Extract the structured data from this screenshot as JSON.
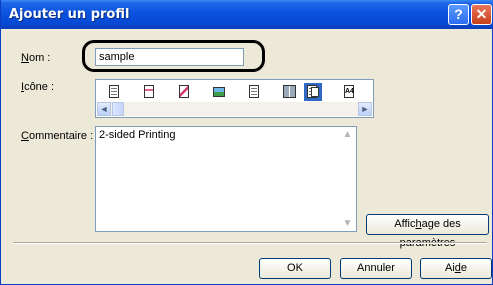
{
  "window": {
    "title": "Ajouter un profil"
  },
  "titlebar": {
    "help_glyph": "?",
    "close_glyph": "✕"
  },
  "name": {
    "label_first": "N",
    "label_rest": "om :",
    "value": "sample"
  },
  "icon_picker": {
    "label_first": "I",
    "label_rest": "cône :",
    "items": [
      "doc-icon",
      "color-doc-icon",
      "poster-icon",
      "photo-icon",
      "booklet-icon",
      "twoup-icon",
      "duplex-icon",
      "a4-icon"
    ],
    "a4_text": "A4",
    "selected_index": 6,
    "scroll_left": "◄",
    "scroll_right": "►"
  },
  "comment": {
    "label_first": "C",
    "label_rest": "ommentaire :",
    "value": "2-sided Printing",
    "scroll_up": "▲",
    "scroll_down": "▼"
  },
  "buttons": {
    "settings_pre": "Affic",
    "settings_ul": "h",
    "settings_post": "age des paramètres",
    "ok": "OK",
    "cancel": "Annuler",
    "help_pre": "Ai",
    "help_ul": "d",
    "help_post": "e"
  },
  "colors": {
    "titlebar": "#0a52df",
    "dialog_bg": "#ece9d8",
    "selection": "#316ac5"
  }
}
